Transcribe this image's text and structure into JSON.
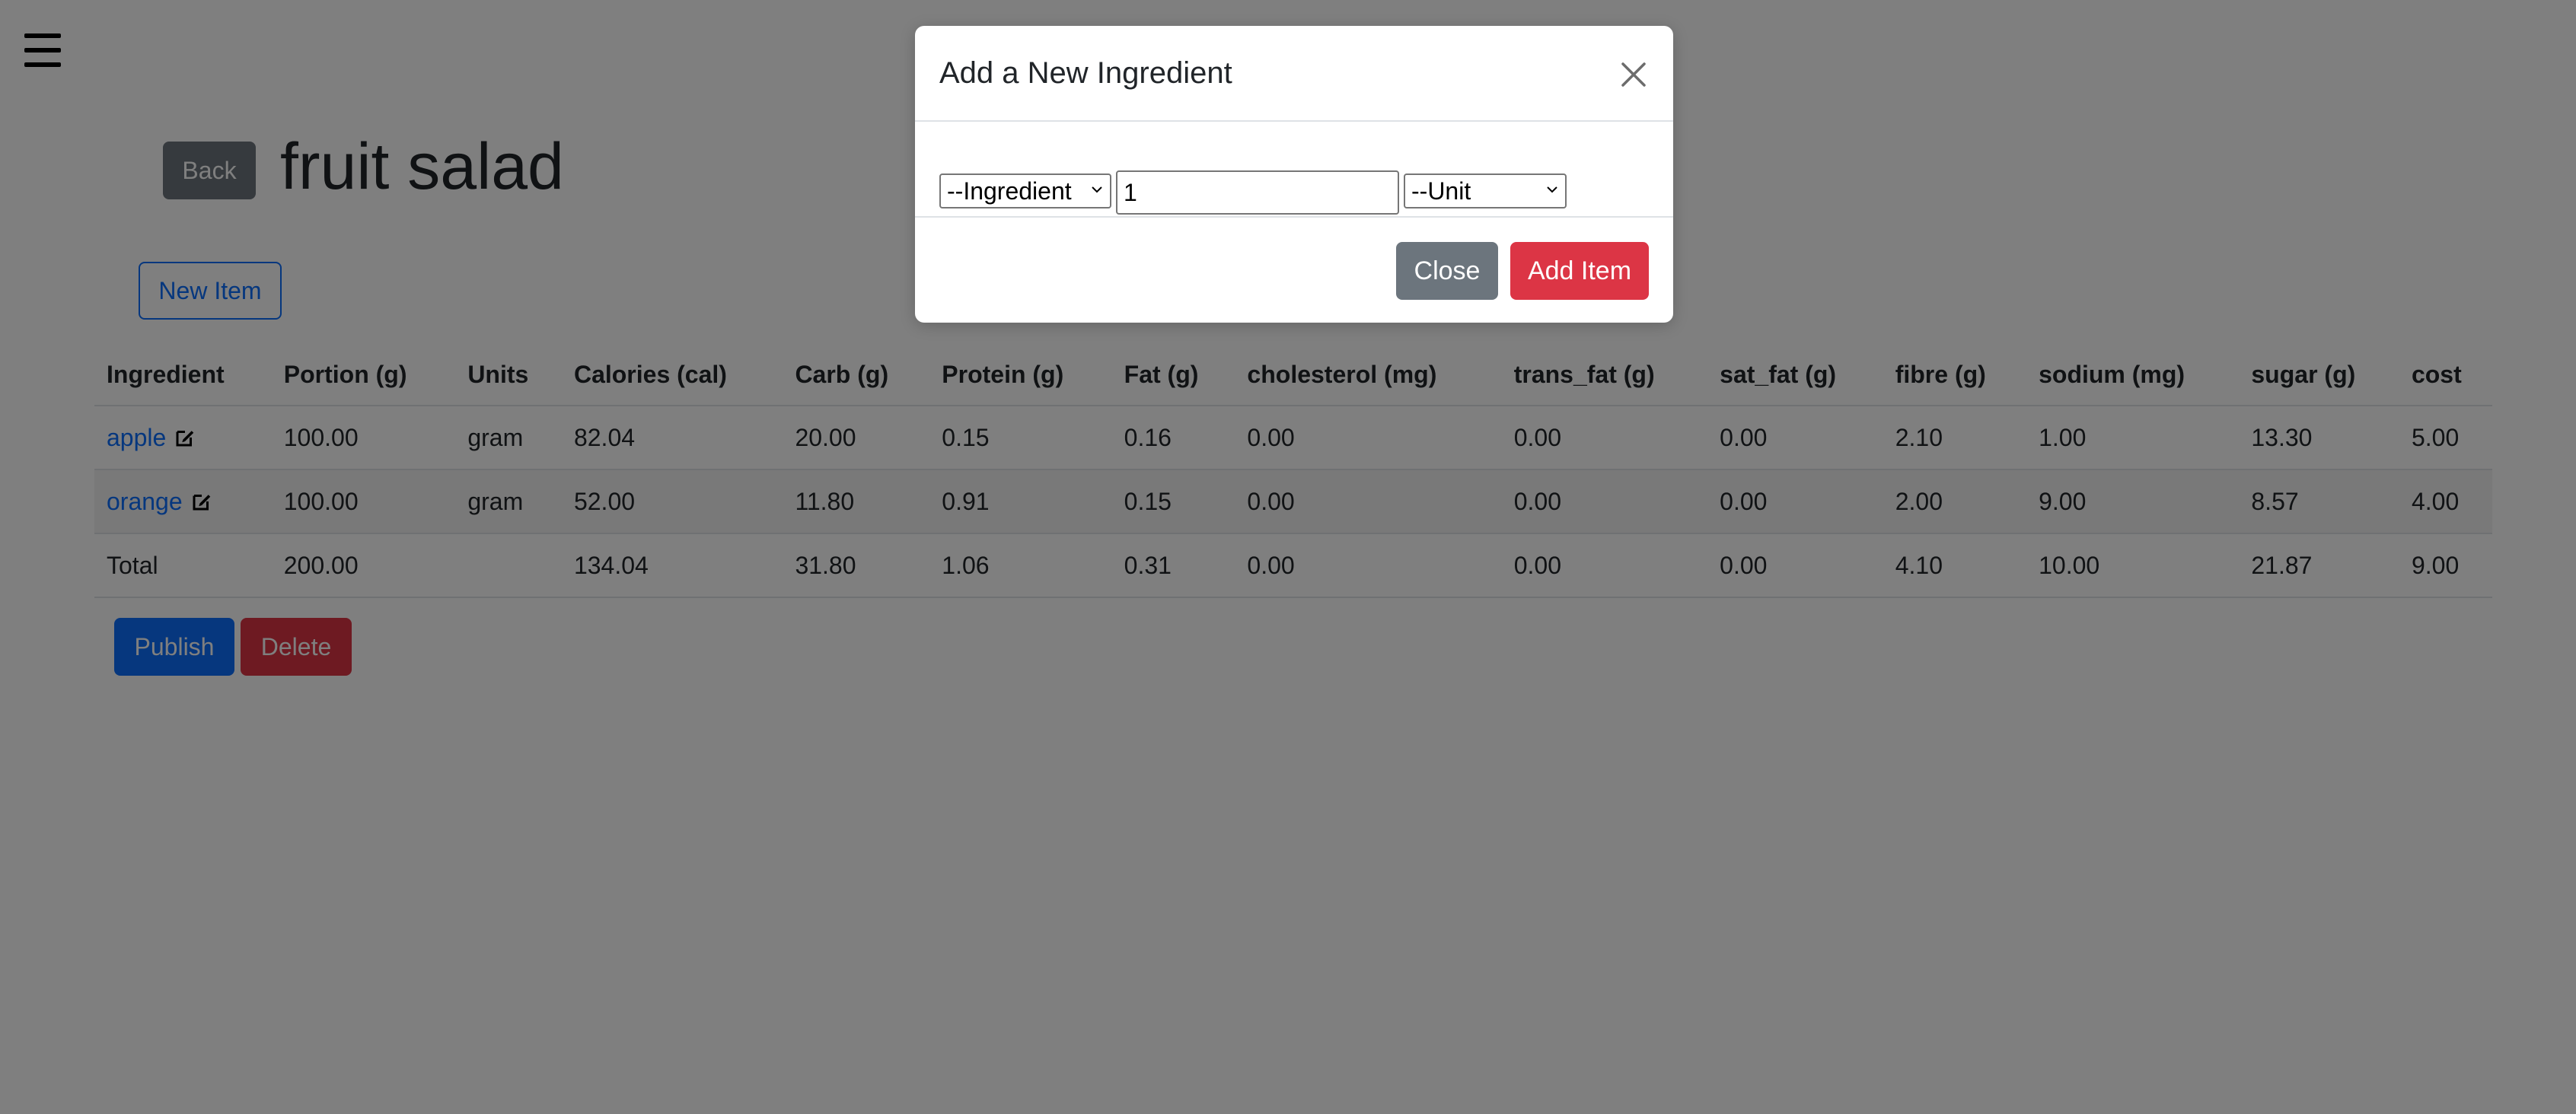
{
  "recipe": {
    "title": "fruit salad",
    "back_label": "Back",
    "new_item_label": "New Item",
    "publish_label": "Publish",
    "delete_label": "Delete"
  },
  "table": {
    "columns": [
      "Ingredient",
      "Portion (g)",
      "Units",
      "Calories (cal)",
      "Carb (g)",
      "Protein (g)",
      "Fat (g)",
      "cholesterol (mg)",
      "trans_fat (g)",
      "sat_fat (g)",
      "fibre (g)",
      "sodium (mg)",
      "sugar (g)",
      "cost"
    ],
    "rows": [
      {
        "ingredient": "apple",
        "portion": "100.00",
        "units": "gram",
        "calories": "82.04",
        "carb": "20.00",
        "protein": "0.15",
        "fat": "0.16",
        "cholesterol": "0.00",
        "trans_fat": "0.00",
        "sat_fat": "0.00",
        "fibre": "2.10",
        "sodium": "1.00",
        "sugar": "13.30",
        "cost": "5.00"
      },
      {
        "ingredient": "orange",
        "portion": "100.00",
        "units": "gram",
        "calories": "52.00",
        "carb": "11.80",
        "protein": "0.91",
        "fat": "0.15",
        "cholesterol": "0.00",
        "trans_fat": "0.00",
        "sat_fat": "0.00",
        "fibre": "2.00",
        "sodium": "9.00",
        "sugar": "8.57",
        "cost": "4.00"
      }
    ],
    "total": {
      "label": "Total",
      "portion": "200.00",
      "units": "",
      "calories": "134.04",
      "carb": "31.80",
      "protein": "1.06",
      "fat": "0.31",
      "cholesterol": "0.00",
      "trans_fat": "0.00",
      "sat_fat": "0.00",
      "fibre": "4.10",
      "sodium": "10.00",
      "sugar": "21.87",
      "cost": "9.00"
    }
  },
  "modal": {
    "title": "Add a New Ingredient",
    "ingredient_select": "--Ingredient",
    "amount_value": "1",
    "unit_select": "--Unit",
    "close_label": "Close",
    "add_label": "Add Item"
  },
  "colors": {
    "primary": "#0d6efd",
    "secondary": "#6c757d",
    "danger": "#dc3545",
    "backdrop": "rgba(0,0,0,0.5)"
  },
  "icons": {
    "menu": "hamburger-menu-icon",
    "edit": "edit-icon",
    "close": "close-icon",
    "caret": "chevron-down-icon"
  }
}
